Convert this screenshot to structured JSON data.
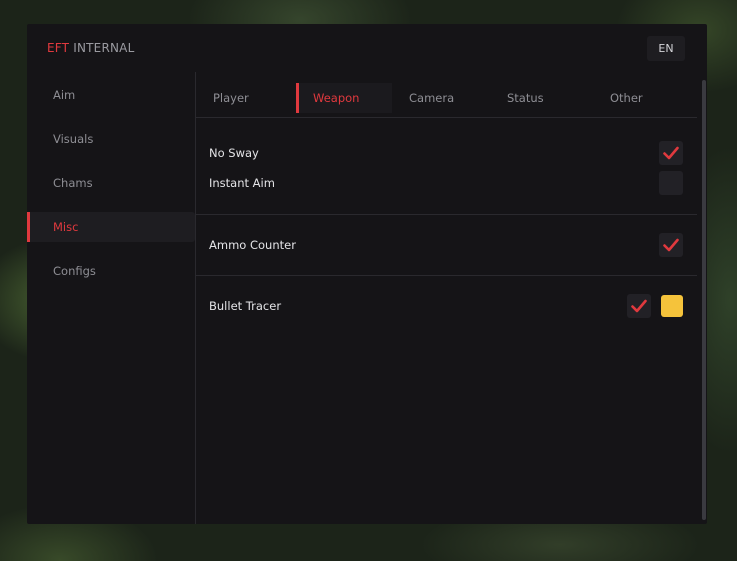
{
  "brand": {
    "accent": "EFT",
    "rest": "INTERNAL"
  },
  "language": "EN",
  "sidebar": {
    "items": [
      {
        "label": "Aim",
        "active": false
      },
      {
        "label": "Visuals",
        "active": false
      },
      {
        "label": "Chams",
        "active": false
      },
      {
        "label": "Misc",
        "active": true
      },
      {
        "label": "Configs",
        "active": false
      }
    ]
  },
  "tabs": [
    {
      "label": "Player",
      "active": false
    },
    {
      "label": "Weapon",
      "active": true
    },
    {
      "label": "Camera",
      "active": false
    },
    {
      "label": "Status",
      "active": false
    },
    {
      "label": "Other",
      "active": false
    }
  ],
  "settings": {
    "no_sway": {
      "label": "No Sway",
      "checked": true
    },
    "instant_aim": {
      "label": "Instant Aim",
      "checked": false
    },
    "ammo_counter": {
      "label": "Ammo Counter",
      "checked": true
    },
    "bullet_tracer": {
      "label": "Bullet Tracer",
      "checked": true,
      "color": "#f5c33b"
    }
  },
  "colors": {
    "accent": "#e0393e",
    "window_bg": "#151417",
    "control_bg": "#222126"
  }
}
